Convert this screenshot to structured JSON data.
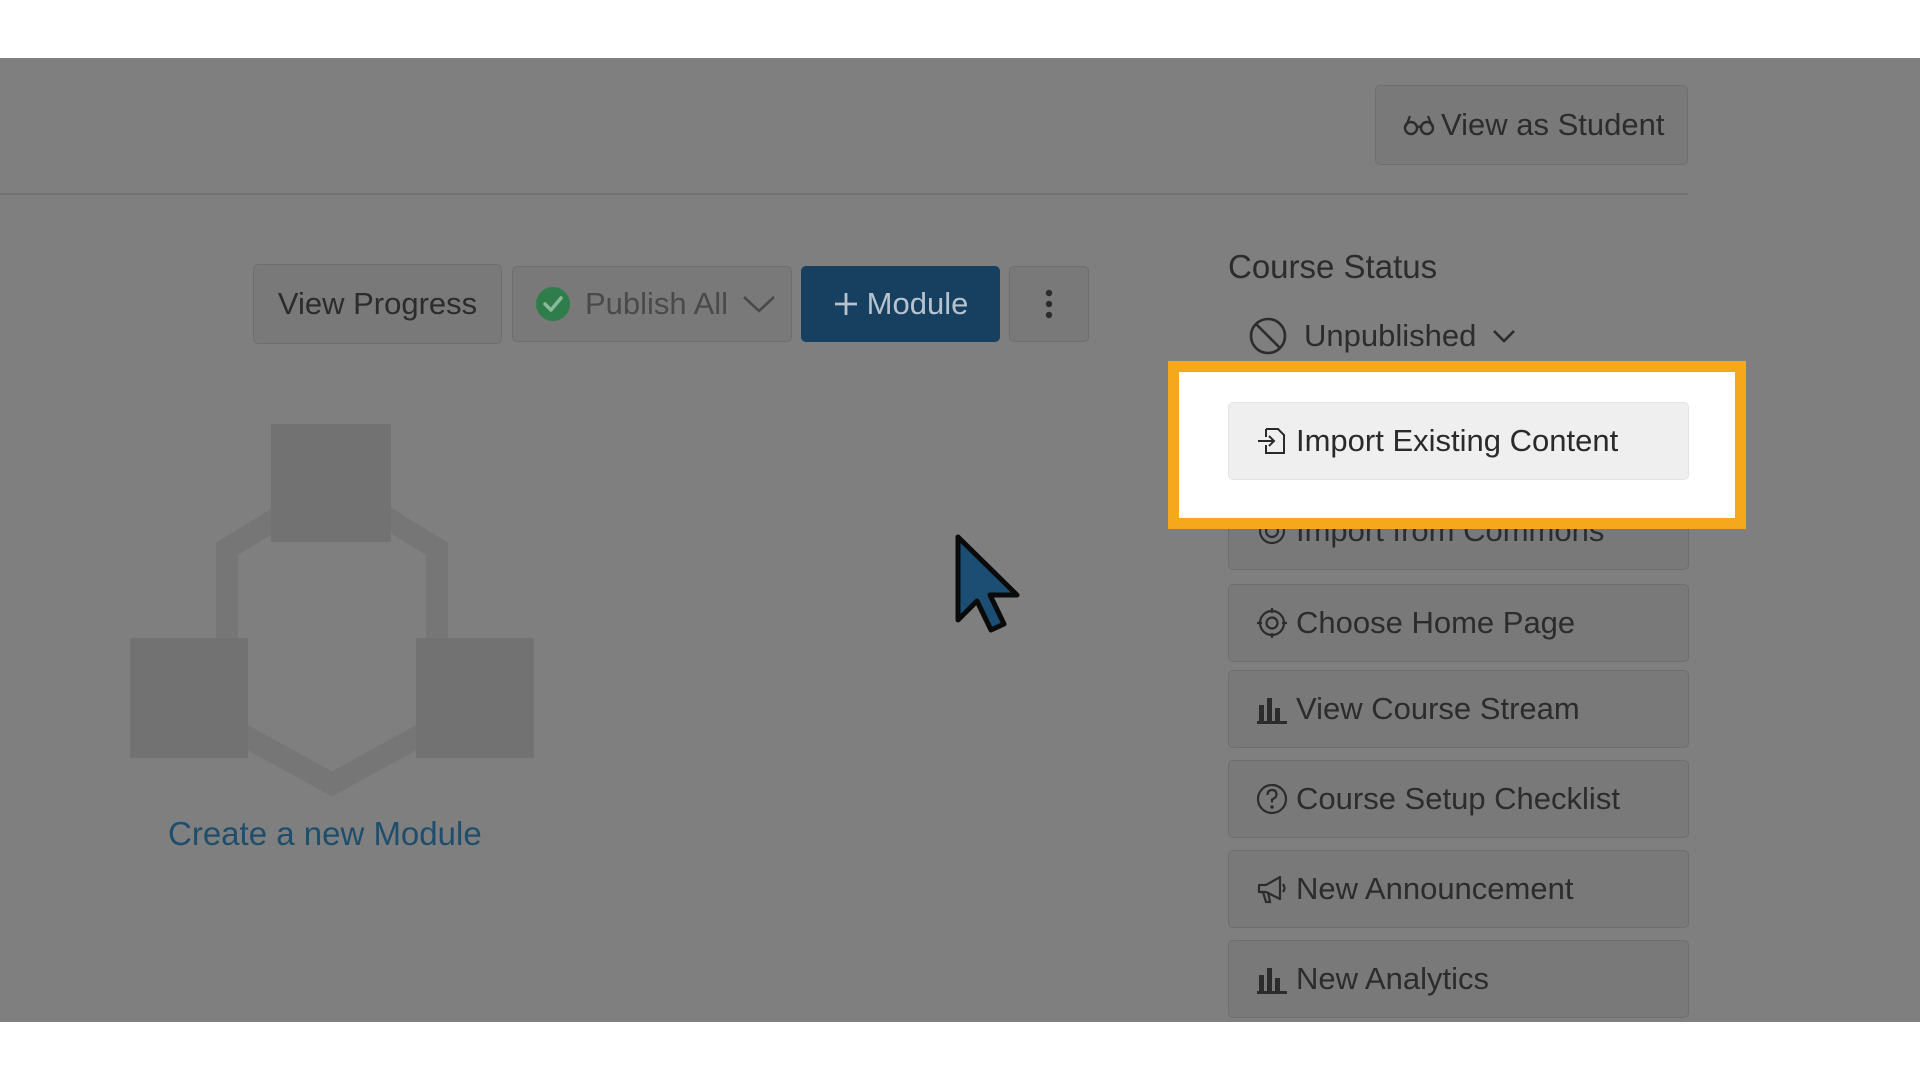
{
  "header": {
    "view_as_student": "View as Student"
  },
  "toolbar": {
    "view_progress": "View Progress",
    "publish_all": "Publish All",
    "add_module": "Module"
  },
  "empty_state": {
    "create_module": "Create a new Module"
  },
  "sidebar": {
    "course_status_title": "Course Status",
    "status_value": "Unpublished",
    "buttons": [
      {
        "label": "Import Existing Content",
        "icon": "import-icon"
      },
      {
        "label": "Import from Commons",
        "icon": "commons-icon"
      },
      {
        "label": "Choose Home Page",
        "icon": "target-icon"
      },
      {
        "label": "View Course Stream",
        "icon": "bar-chart-icon"
      },
      {
        "label": "Course Setup Checklist",
        "icon": "question-circle-icon"
      },
      {
        "label": "New Announcement",
        "icon": "megaphone-icon"
      },
      {
        "label": "New Analytics",
        "icon": "bar-chart-icon"
      }
    ]
  },
  "colors": {
    "overlay": "#7f7f7f",
    "primary_button": "#173f60",
    "highlight": "#f6a81d",
    "publish_check": "#2e7d4a",
    "link": "#1f4e6c"
  }
}
